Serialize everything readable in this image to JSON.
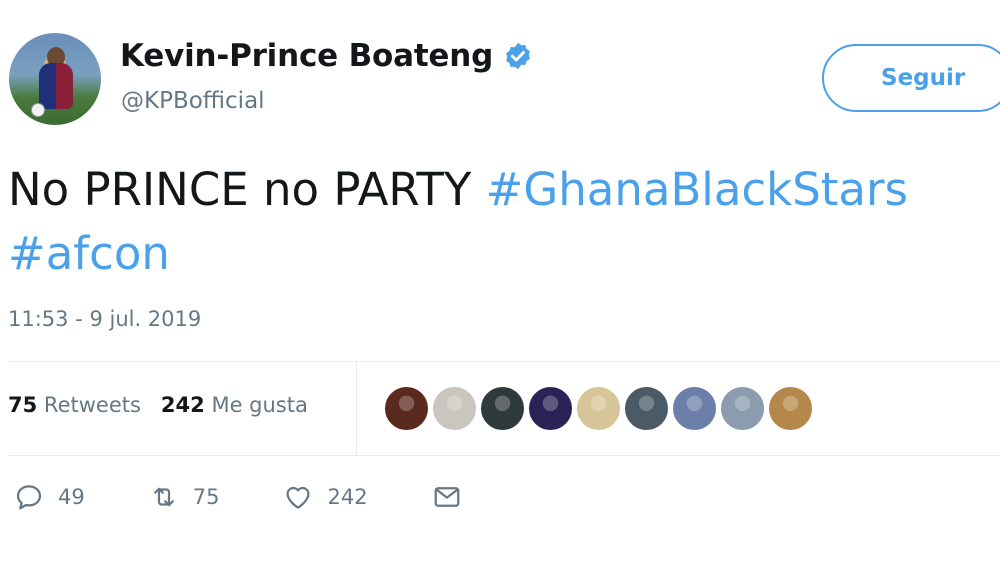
{
  "user": {
    "name": "Kevin-Prince Boateng",
    "handle": "@KPBofficial",
    "verified": true
  },
  "follow_button": {
    "label": "Seguir"
  },
  "tweet": {
    "text_plain": "No PRINCE no PARTY ",
    "hashtag_1": "#GhanaBlackStars",
    "hashtag_2": "#afcon",
    "timestamp": "11:53 - 9 jul. 2019"
  },
  "stats": {
    "retweets_count": "75",
    "retweets_label": "Retweets",
    "likes_count": "242",
    "likes_label": "Me gusta"
  },
  "likers": [
    {
      "name": "liker-avatar-1",
      "color": "#5a2a1e"
    },
    {
      "name": "liker-avatar-2",
      "color": "#c8c6be"
    },
    {
      "name": "liker-avatar-3",
      "color": "#2f3a3a"
    },
    {
      "name": "liker-avatar-4",
      "color": "#2a2456"
    },
    {
      "name": "liker-avatar-5",
      "color": "#d7c59a"
    },
    {
      "name": "liker-avatar-6",
      "color": "#4a5a66"
    },
    {
      "name": "liker-avatar-7",
      "color": "#6c7fa8"
    },
    {
      "name": "liker-avatar-8",
      "color": "#8a9cae"
    },
    {
      "name": "liker-avatar-9",
      "color": "#b5874a"
    }
  ],
  "actions": {
    "reply": {
      "icon": "reply-icon",
      "count": "49"
    },
    "retweet": {
      "icon": "retweet-icon",
      "count": "75"
    },
    "like": {
      "icon": "heart-icon",
      "count": "242"
    },
    "message": {
      "icon": "envelope-icon"
    }
  },
  "colors": {
    "accent": "#4aa1e9",
    "secondary_text": "#657786",
    "primary_text": "#14171a",
    "divider": "#e6ecf0"
  }
}
